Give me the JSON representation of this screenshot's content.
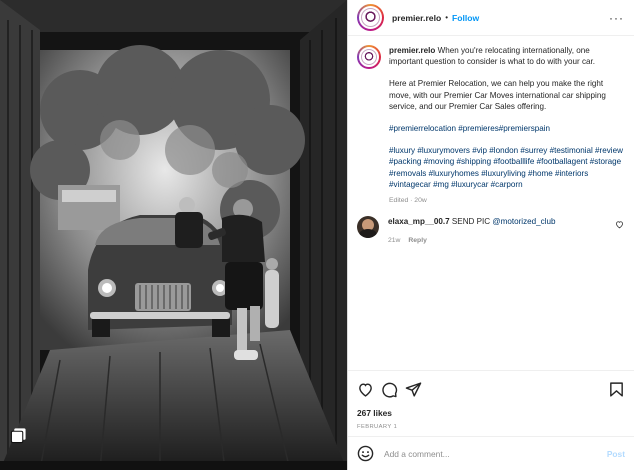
{
  "header": {
    "username": "premier.relo",
    "separator": "•",
    "follow_label": "Follow",
    "more_label": "···"
  },
  "caption": {
    "username": "premier.relo",
    "intro": "When you're relocating internationally, one important question to consider is what to do with your car.",
    "paragraph2": "Here at Premier Relocation, we can help you make the right move, with our Premier Car Moves international car shipping service, and our Premier Car Sales offering.",
    "hashtags1": "#premierrelocation #premieres#premierspain",
    "hashtags2": "#luxury #luxurymovers #vip #london #surrey #testimonial #review #packing #moving #shipping #footballlife #footballagent #storage #removals #luxuryhomes #luxuryliving #home #interiors #vintagecar #mg #luxurycar #carporn",
    "meta": "Edited · 20w"
  },
  "comment": {
    "username": "elaxa_mp__00.7",
    "text": "SEND PIC",
    "mention": "@motorized_club",
    "age": "21w",
    "reply_label": "Reply"
  },
  "actions": {
    "likes": "267 likes",
    "date": "FEBRUARY 1"
  },
  "add_comment": {
    "placeholder": "Add a comment...",
    "post_label": "Post"
  },
  "icons": [
    "heart-icon",
    "comment-icon",
    "share-icon",
    "bookmark-icon",
    "emoji-icon",
    "carousel-icon"
  ],
  "colors": {
    "accent": "#0095f6",
    "hashtag": "#00376b",
    "muted": "#8e8e8e"
  }
}
